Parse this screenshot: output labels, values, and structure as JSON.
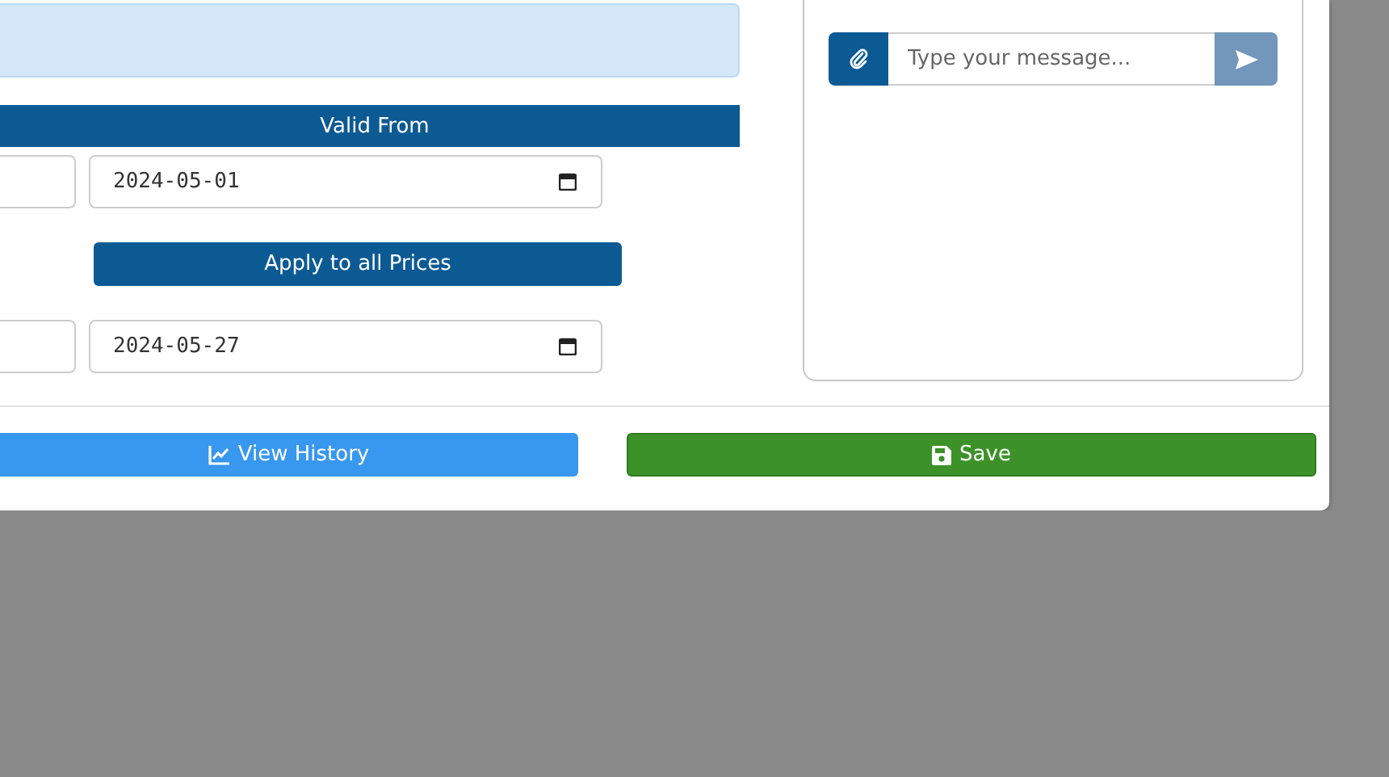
{
  "price_form": {
    "column_header": "Valid From",
    "date_rows": [
      {
        "value": "2024-05-01"
      },
      {
        "value": "2024-05-27"
      }
    ],
    "apply_button": "Apply to all Prices"
  },
  "chat": {
    "placeholder": "Type your message..."
  },
  "footer": {
    "buttons": [
      {
        "kind": "history",
        "label": "View History"
      },
      {
        "kind": "save",
        "label": "Save"
      }
    ]
  }
}
